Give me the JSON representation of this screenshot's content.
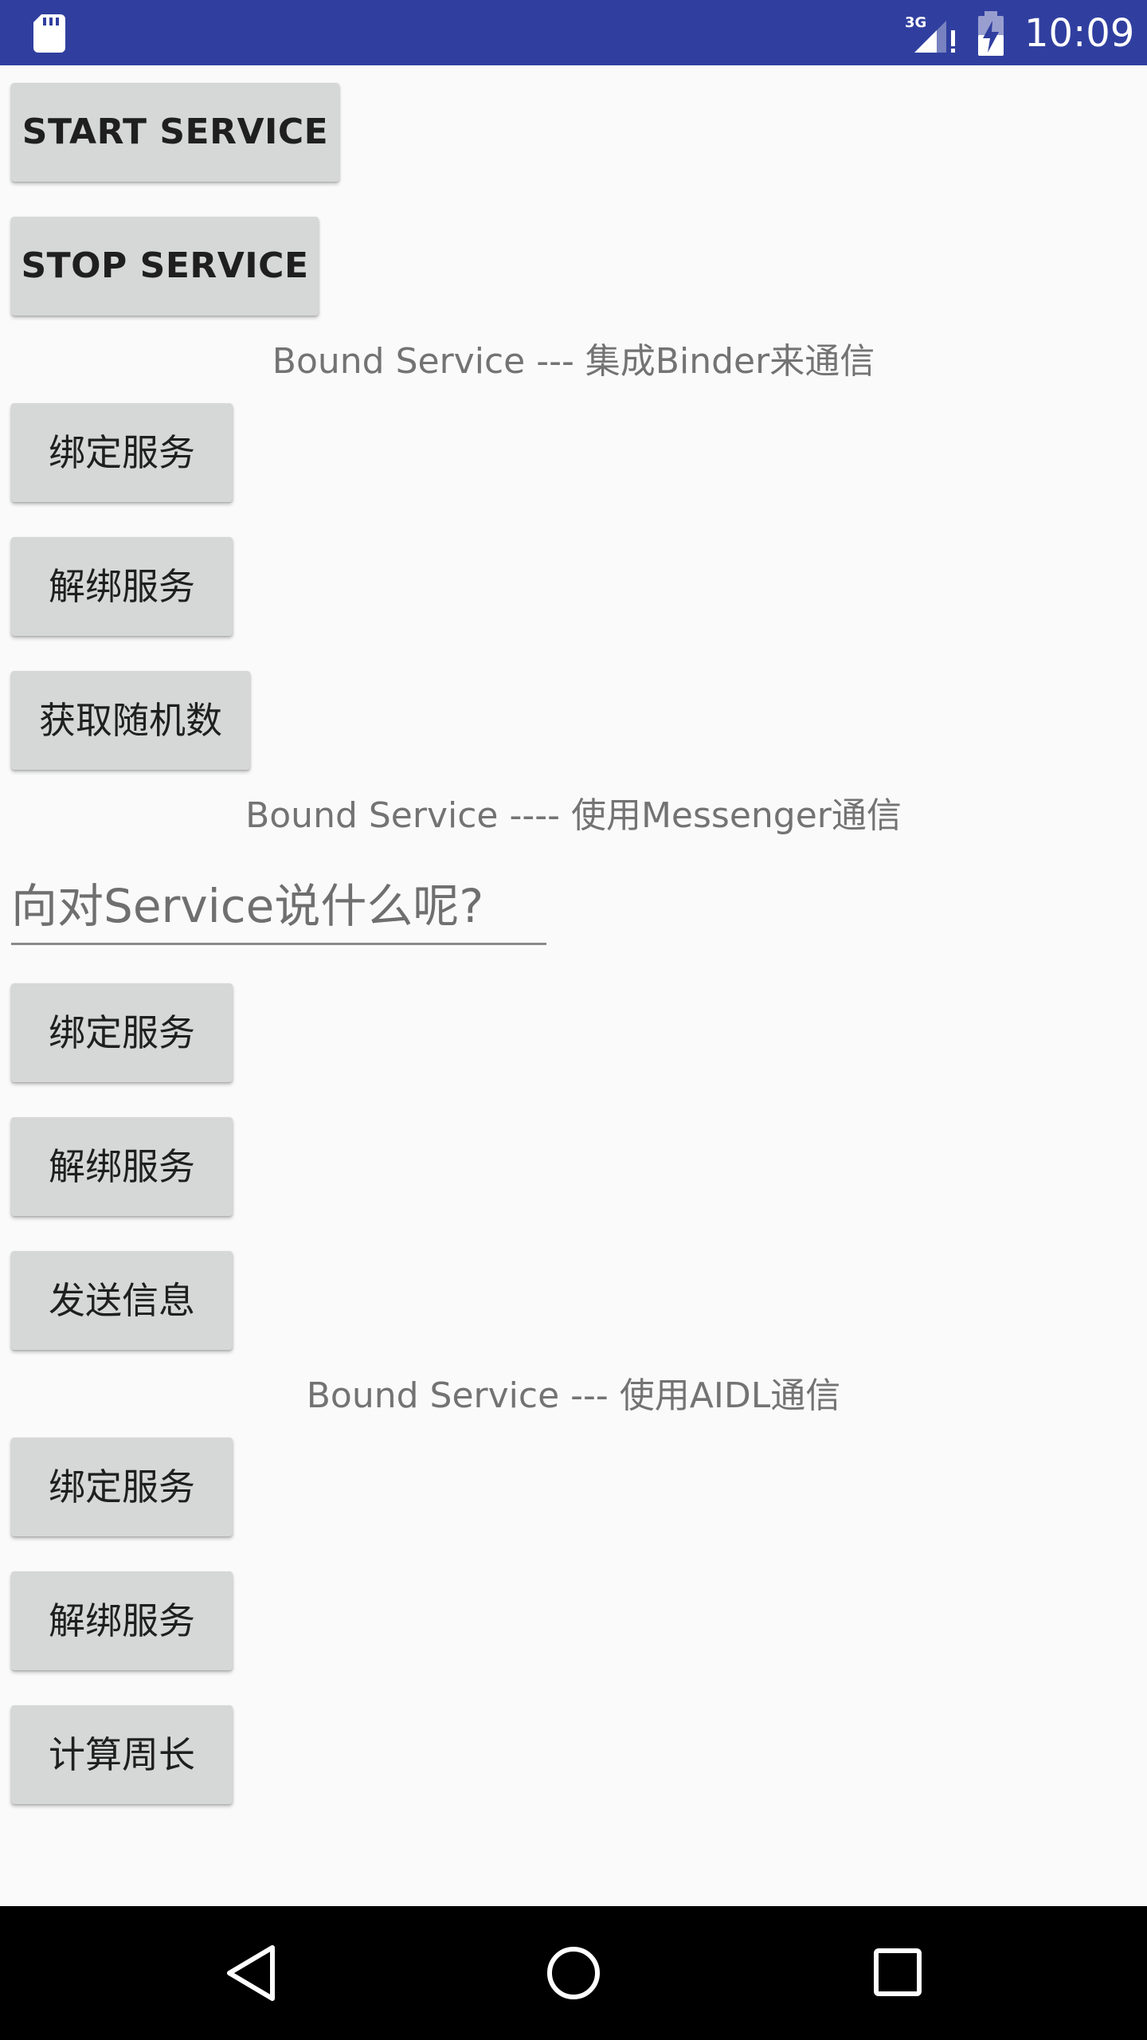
{
  "status_bar": {
    "time": "10:09",
    "network_type": "3G",
    "icons": [
      "sd-card-icon",
      "signal-icon",
      "battery-charging-icon"
    ],
    "background_color": "#303f9f"
  },
  "service_section": {
    "start_label": "START SERVICE",
    "stop_label": "STOP SERVICE"
  },
  "binder_section": {
    "title": "Bound Service --- 集成Binder来通信",
    "bind_label": "绑定服务",
    "unbind_label": "解绑服务",
    "random_label": "获取随机数"
  },
  "messenger_section": {
    "title": "Bound Service ---- 使用Messenger通信",
    "input_value": "",
    "input_placeholder": "向对Service说什么呢?",
    "bind_label": "绑定服务",
    "unbind_label": "解绑服务",
    "send_label": "发送信息"
  },
  "aidl_section": {
    "title": "Bound Service --- 使用AIDL通信",
    "bind_label": "绑定服务",
    "unbind_label": "解绑服务",
    "perimeter_label": "计算周长"
  },
  "nav_bar": {
    "icons": [
      "back-icon",
      "home-icon",
      "recents-icon"
    ]
  },
  "colors": {
    "button_bg": "#d6d7d7",
    "label_text": "#737373",
    "page_bg": "#fafafa"
  }
}
